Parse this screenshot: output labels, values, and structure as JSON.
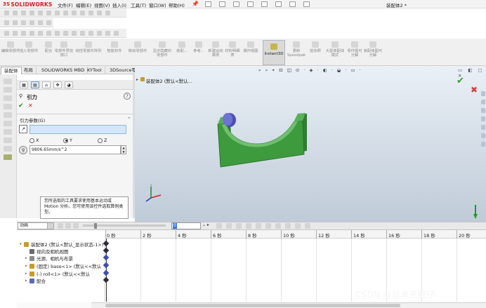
{
  "titlebar": {
    "brand": "SOLIDWORKS",
    "menus": [
      "文件(F)",
      "编辑(E)",
      "视图(V)",
      "插入(I)",
      "工具(T)",
      "窗口(W)",
      "帮助(H)"
    ],
    "document_title": "装配体2 *"
  },
  "command_manager": {
    "commands": [
      "编辑零部件",
      "插入零部件",
      "配合",
      "零部件预览窗口",
      "线性零部件阵列",
      "智能扣件",
      "移动零部件",
      "显示隐藏的零部件",
      "装配...",
      "参考...",
      "新建运动算例",
      "材料明细表",
      "爆炸视图"
    ],
    "instant3d": "Instant3D",
    "commands_right": [
      "更新Speedpak",
      "拍快照",
      "大型装配体模式",
      "零件图可分解",
      "装配体图可分解"
    ]
  },
  "tabs": [
    "装配体",
    "布局",
    "SOLIDWORKS MBD",
    "KYTool",
    "3DSource零件库"
  ],
  "property_manager": {
    "title": "引力",
    "group_title": "引力参数(G)",
    "radio_options": [
      "X",
      "Y",
      "Z"
    ],
    "selected_axis": "Y",
    "direction_value": "",
    "acceleration": "9806.65mm/s^2",
    "tabs": [
      "feature-manager",
      "property-manager",
      "configuration-manager",
      "dimxpert",
      "display-manager"
    ]
  },
  "viewport": {
    "tree_label": "装配体2 (默认<默认..."
  },
  "note": {
    "text": "您所选取的工具要求使用基本运动或Motion 分析。您可使用该控件选取算例类型。"
  },
  "motion": {
    "study_type": "动画",
    "time_selected": "0",
    "time_field": "0 秒",
    "timeline_labels": [
      "0 秒",
      "2 秒",
      "4 秒",
      "6 秒",
      "8 秒",
      "10 秒",
      "12 秒",
      "14 秒",
      "16 秒",
      "18 秒",
      "20 秒"
    ],
    "tree": [
      {
        "label": "装配体2 (默认<默认_显示状态-1>)",
        "expander": "▾",
        "color": "#c99a2e"
      },
      {
        "label": "视向及相机视图",
        "expander": "",
        "color": "#6a6a6a"
      },
      {
        "label": "光源、相机与布景",
        "expander": "▸",
        "color": "#8a8a8a"
      },
      {
        "label": "(固定) base<1> (默认<<默认",
        "expander": "▸",
        "color": "#c99a2e"
      },
      {
        "label": "(-) roll<1> (默认<<默认",
        "expander": "▸",
        "color": "#c99a2e"
      },
      {
        "label": "配合",
        "expander": "▸",
        "color": "#5a6ab8"
      }
    ]
  },
  "watermark": "CSDN @技术死肥仔",
  "colors": {
    "part_green": "#3d9a3d",
    "roll_blue": "#4c4fb2",
    "viewport_top": "#eaf0f6",
    "viewport_bottom": "#bfcbd8",
    "accent_red": "#d71920"
  }
}
